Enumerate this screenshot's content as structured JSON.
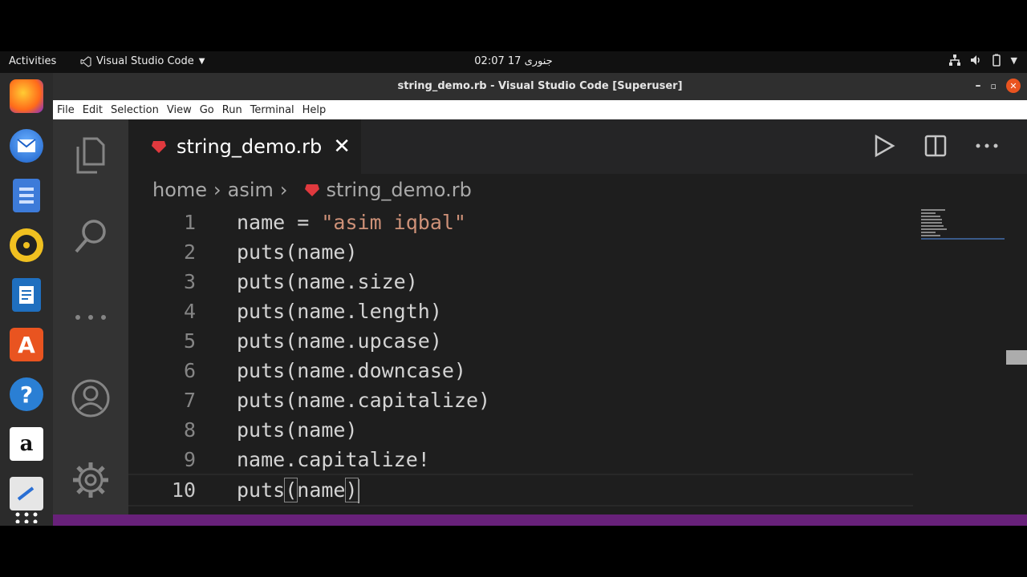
{
  "topbar": {
    "activities": "Activities",
    "app_name": "Visual Studio Code",
    "clock": "02:07  جنوری 17"
  },
  "window": {
    "title": "string_demo.rb - Visual Studio Code [Superuser]"
  },
  "menubar": {
    "items": [
      "File",
      "Edit",
      "Selection",
      "View",
      "Go",
      "Run",
      "Terminal",
      "Help"
    ]
  },
  "tab": {
    "name": "string_demo.rb",
    "close": "✕"
  },
  "breadcrumb": {
    "parts": [
      "home",
      "asim",
      "string_demo.rb"
    ]
  },
  "code": {
    "lines": [
      {
        "n": "1",
        "pre": "name = ",
        "str": "\"asim iqbal\"",
        "post": ""
      },
      {
        "n": "2",
        "pre": "puts(name)"
      },
      {
        "n": "3",
        "pre": "puts(name.size)"
      },
      {
        "n": "4",
        "pre": "puts(name.length)"
      },
      {
        "n": "5",
        "pre": "puts(name.upcase)"
      },
      {
        "n": "6",
        "pre": "puts(name.downcase)"
      },
      {
        "n": "7",
        "pre": "puts(name.capitalize)"
      },
      {
        "n": "8",
        "pre": "puts(name)"
      },
      {
        "n": "9",
        "pre": "name.capitalize!"
      },
      {
        "n": "10",
        "a": "puts",
        "b": "(",
        "c": "name",
        "d": ")"
      }
    ]
  },
  "colors": {
    "accent_status": "#68217a",
    "ruby_icon": "#e0393e",
    "string": "#ce9178",
    "code_text": "#d4d4d4"
  },
  "icons": {
    "dock": [
      "firefox-icon",
      "thunderbird-icon",
      "files-icon",
      "rhythmbox-icon",
      "writer-icon",
      "software-icon",
      "help-icon",
      "amazon-icon",
      "editor-icon",
      "app-grid-icon"
    ],
    "activity": [
      "explorer-icon",
      "search-icon",
      "more-icon",
      "account-icon",
      "settings-gear-icon"
    ]
  }
}
